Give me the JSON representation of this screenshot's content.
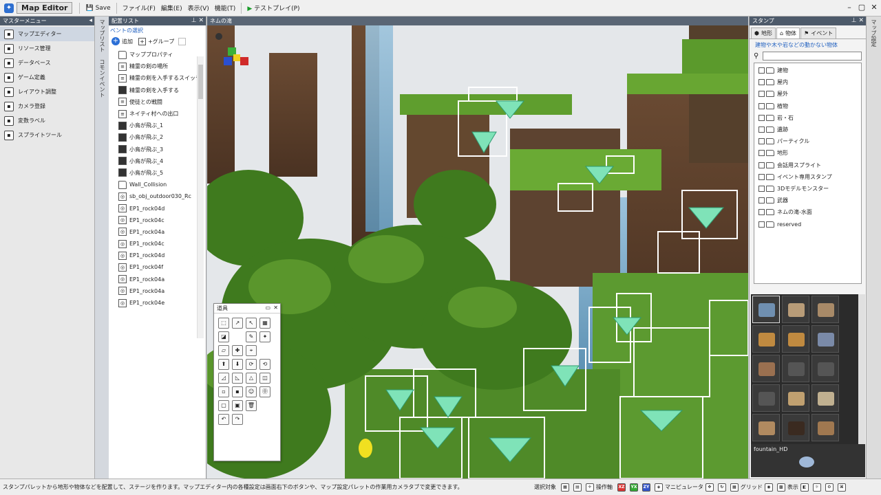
{
  "topbar": {
    "app_title": "Map Editor",
    "save_label": "Save",
    "menus": [
      "ファイル(F)",
      "編集(E)",
      "表示(V)",
      "機能(T)"
    ],
    "test_play_label": "テストプレイ(P)"
  },
  "master_menu": {
    "header": "マスターメニュー",
    "items": [
      {
        "label": "マップエディター",
        "icon": "map-edit-icon"
      },
      {
        "label": "リソース管理",
        "icon": "resource-icon"
      },
      {
        "label": "データベース",
        "icon": "database-icon"
      },
      {
        "label": "ゲーム定義",
        "icon": "game-def-icon"
      },
      {
        "label": "レイアウト調整",
        "icon": "layout-icon"
      },
      {
        "label": "カメラ登録",
        "icon": "camera-icon"
      },
      {
        "label": "変数ラベル",
        "icon": "variable-icon"
      },
      {
        "label": "スプライトツール",
        "icon": "sprite-icon"
      }
    ]
  },
  "side_tabs": {
    "map_list": "マップリスト",
    "common_event": "コモンイベント"
  },
  "placement_list": {
    "header": "配置リスト",
    "sub_title": "ベントの選択",
    "add_label": "追加",
    "add_group_label": "+グループ",
    "items": [
      {
        "label": "マッププロパティ",
        "type": "folder"
      },
      {
        "label": "精霊の剣の場所",
        "type": "event"
      },
      {
        "label": "精霊の剣を入手するスイッチ",
        "type": "event"
      },
      {
        "label": "精霊の剣を入手する",
        "type": "dark"
      },
      {
        "label": "使徒との戦闘",
        "type": "event"
      },
      {
        "label": "ネイティ村への出口",
        "type": "event"
      },
      {
        "label": "小鳥が飛ぶ_1",
        "type": "dark"
      },
      {
        "label": "小鳥が飛ぶ_2",
        "type": "dark"
      },
      {
        "label": "小鳥が飛ぶ_3",
        "type": "dark"
      },
      {
        "label": "小鳥が飛ぶ_4",
        "type": "dark"
      },
      {
        "label": "小鳥が飛ぶ_5",
        "type": "dark"
      },
      {
        "label": "Wall_Collision",
        "type": "folder"
      },
      {
        "label": "sb_obj_outdoor030_Rc",
        "type": "object"
      },
      {
        "label": "EP1_rock04d",
        "type": "object"
      },
      {
        "label": "EP1_rock04c",
        "type": "object"
      },
      {
        "label": "EP1_rock04a",
        "type": "object"
      },
      {
        "label": "EP1_rock04c",
        "type": "object"
      },
      {
        "label": "EP1_rock04d",
        "type": "object"
      },
      {
        "label": "EP1_rock04f",
        "type": "object"
      },
      {
        "label": "EP1_rock04a",
        "type": "object"
      },
      {
        "label": "EP1_rock04a",
        "type": "object"
      },
      {
        "label": "EP1_rock04e",
        "type": "object"
      }
    ]
  },
  "viewport": {
    "header": "ネムの滝"
  },
  "tools_window": {
    "title": "道具"
  },
  "stamp": {
    "header": "スタンプ",
    "tabs": [
      "地形",
      "物体",
      "イベント"
    ],
    "description": "建物や木や岩などの動かない物体",
    "categories": [
      "建物",
      "屋内",
      "屋外",
      "植物",
      "岩・石",
      "遺跡",
      "パーティクル",
      "地形",
      "会話用スプライト",
      "イベント専用スタンプ",
      "3Dモデルモンスター",
      "武器",
      "ネムの滝-水面",
      "reserved"
    ],
    "preview_name": "fountain_HD"
  },
  "right_strip": {
    "label": "マップ設定"
  },
  "status": {
    "message": "スタンプパレットから地形や物体などを配置して、ステージを作ります。マップエディター内の各種設定は画面右下のボタンや、マップ設定パレットの作業用カメラタブで変更できます。",
    "select_target": "選択対象",
    "operation": "操作軸",
    "manipulator": "マニピュレータ",
    "grid": "グリッド",
    "display": "表示",
    "xz": "XZ",
    "yx": "YX",
    "zy": "ZY"
  }
}
